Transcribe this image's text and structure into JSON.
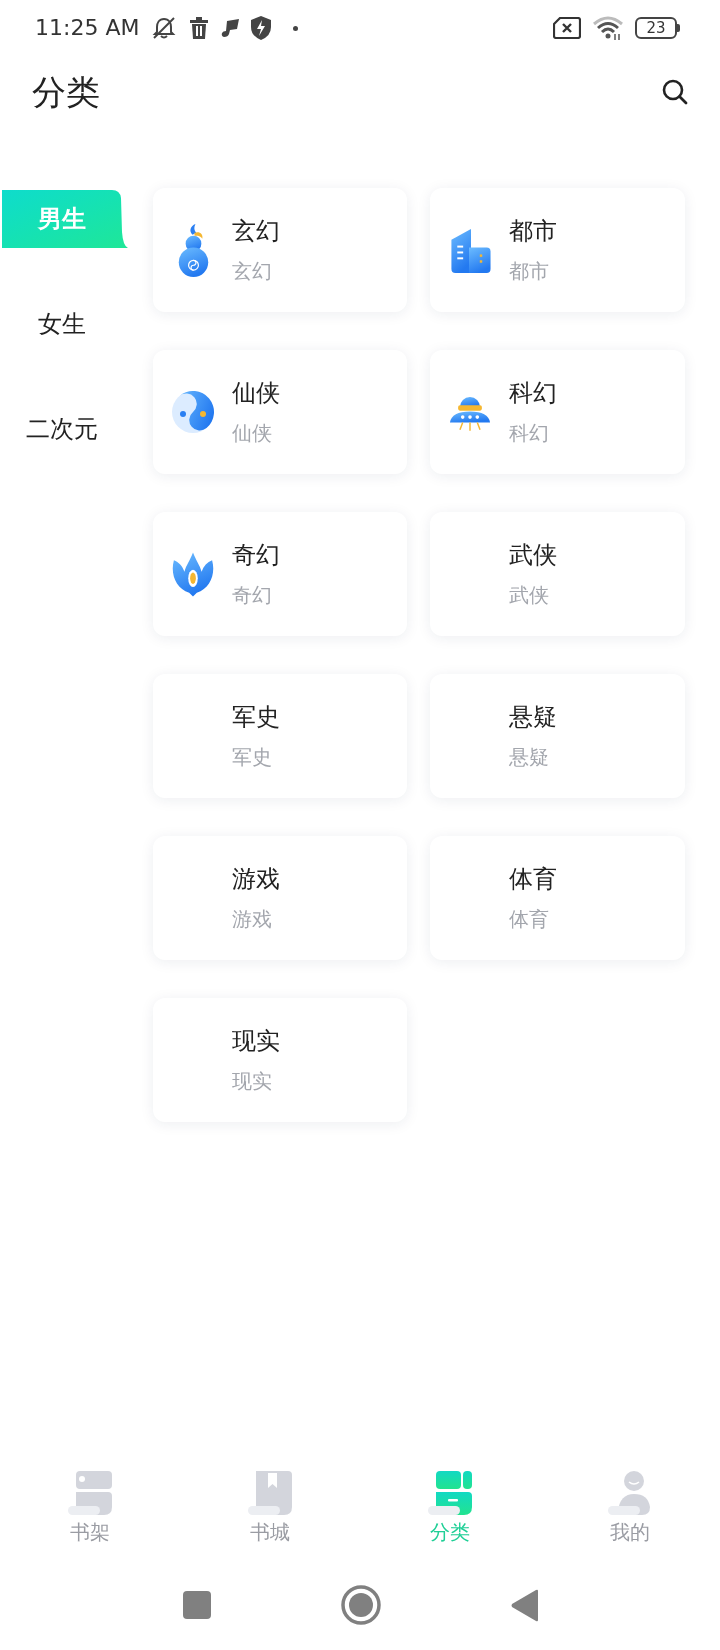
{
  "status_bar": {
    "time": "11:25 AM",
    "battery": "23"
  },
  "header": {
    "title": "分类"
  },
  "sidebar": {
    "items": [
      {
        "label": "男生",
        "selected": true
      },
      {
        "label": "女生",
        "selected": false
      },
      {
        "label": "二次元",
        "selected": false
      }
    ]
  },
  "categories": [
    {
      "kind": "gourd",
      "title": "玄幻",
      "subtitle": "玄幻"
    },
    {
      "kind": "building",
      "title": "都市",
      "subtitle": "都市"
    },
    {
      "kind": "taiji",
      "title": "仙侠",
      "subtitle": "仙侠"
    },
    {
      "kind": "ufo",
      "title": "科幻",
      "subtitle": "科幻"
    },
    {
      "kind": "flame",
      "title": "奇幻",
      "subtitle": "奇幻"
    },
    {
      "kind": "plain",
      "title": "武侠",
      "subtitle": "武侠"
    },
    {
      "kind": "plain",
      "title": "军史",
      "subtitle": "军史"
    },
    {
      "kind": "plain",
      "title": "悬疑",
      "subtitle": "悬疑"
    },
    {
      "kind": "plain",
      "title": "游戏",
      "subtitle": "游戏"
    },
    {
      "kind": "plain",
      "title": "体育",
      "subtitle": "体育"
    },
    {
      "kind": "plain",
      "title": "现实",
      "subtitle": "现实"
    }
  ],
  "bottom_nav": [
    {
      "kind": "shelf",
      "label": "书架",
      "selected": false
    },
    {
      "kind": "store",
      "label": "书城",
      "selected": false
    },
    {
      "kind": "category",
      "label": "分类",
      "selected": true
    },
    {
      "kind": "profile",
      "label": "我的",
      "selected": false
    }
  ]
}
